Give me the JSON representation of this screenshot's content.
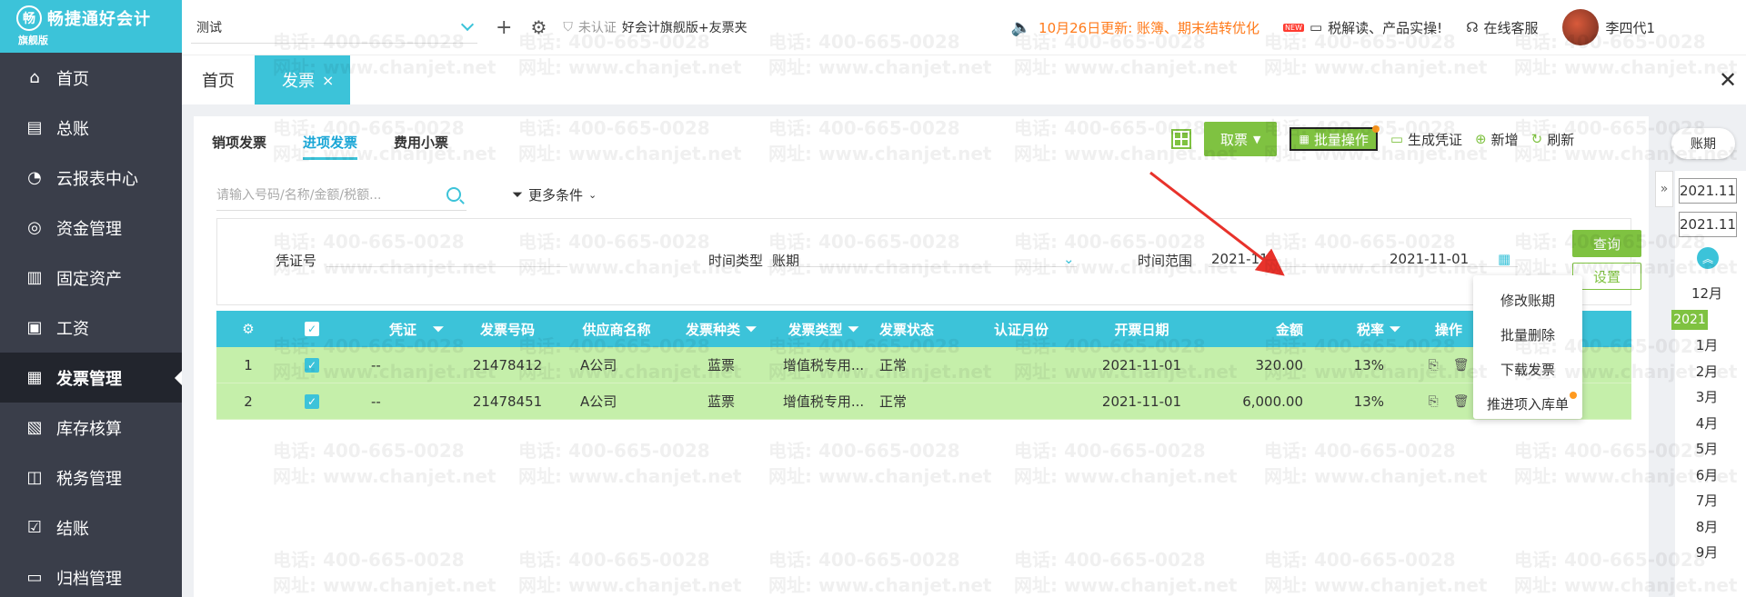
{
  "brand": {
    "logo_glyph": "畅",
    "name": "畅捷通好会计",
    "edition": "旗舰版"
  },
  "sidebar": {
    "items": [
      {
        "label": "首页",
        "icon": "home-icon"
      },
      {
        "label": "总账",
        "icon": "ledger-icon"
      },
      {
        "label": "云报表中心",
        "icon": "chart-icon"
      },
      {
        "label": "资金管理",
        "icon": "fund-icon"
      },
      {
        "label": "固定资产",
        "icon": "building-icon"
      },
      {
        "label": "工资",
        "icon": "salary-icon"
      },
      {
        "label": "发票管理",
        "icon": "invoice-icon",
        "active": true
      },
      {
        "label": "库存核算",
        "icon": "warehouse-icon"
      },
      {
        "label": "税务管理",
        "icon": "tax-icon"
      },
      {
        "label": "结账",
        "icon": "checkout-icon"
      },
      {
        "label": "归档管理",
        "icon": "archive-icon"
      }
    ]
  },
  "topbar": {
    "account": "测试",
    "cert_status": "未认证",
    "product": "好会计旗舰版+友票夹",
    "notice": "10月26日更新: 账簿、期末结转优化",
    "new_badge": "NEW",
    "video_link": "税解读、产品实操!",
    "support": "在线客服",
    "user_name": "李四代1"
  },
  "tabs": {
    "home": "首页",
    "invoice": "发票",
    "close": "×"
  },
  "sub_tabs": [
    "销项发票",
    "进项发票",
    "费用小票"
  ],
  "toolbar": {
    "take_invoice": "取票",
    "batch": "批量操作",
    "gen_voucher": "生成凭证",
    "add": "新增",
    "refresh": "刷新"
  },
  "period_tag": "账期",
  "dropdown": [
    "修改账期",
    "批量删除",
    "下载发票",
    "推进项入库单"
  ],
  "search": {
    "placeholder": "请输入号码/名称/金额/税额...",
    "more": "更多条件"
  },
  "filters": {
    "voucher_label": "凭证号",
    "time_type_label": "时间类型",
    "time_type_value": "账期",
    "range_label": "时间范围",
    "range_start": "2021-11-01",
    "range_end": "2021-11-01",
    "query": "查询",
    "setting": "设置"
  },
  "table": {
    "headers": [
      "凭证",
      "发票号码",
      "供应商名称",
      "发票种类",
      "发票类型",
      "发票状态",
      "认证月份",
      "开票日期",
      "金额",
      "税率",
      "操作"
    ],
    "rows": [
      {
        "no": "1",
        "voucher": "--",
        "number": "21478412",
        "supplier": "A公司",
        "kind": "蓝票",
        "type": "增值税专用...",
        "status": "正常",
        "cert_month": "",
        "date": "2021-11-01",
        "amount": "320.00",
        "rate": "13%"
      },
      {
        "no": "2",
        "voucher": "--",
        "number": "21478451",
        "supplier": "A公司",
        "kind": "蓝票",
        "type": "增值税专用...",
        "status": "正常",
        "cert_month": "",
        "date": "2021-11-01",
        "amount": "6,000.00",
        "rate": "13%"
      }
    ]
  },
  "period_panel": {
    "top1": "2021.11",
    "top2": "2021.11",
    "months": [
      "12月",
      "2021",
      "1月",
      "2月",
      "3月",
      "4月",
      "5月",
      "6月",
      "7月",
      "8月",
      "9月"
    ]
  },
  "watermark": {
    "phone": "电话: 400-665-0028",
    "site": "网址: www.chanjet.net"
  },
  "colors": {
    "accent": "#3cc3d9",
    "green": "#7fc241",
    "row": "#c5efaa",
    "sidebar": "#3a3e4a",
    "notice": "#ff7a1a",
    "arrow": "#e8322b"
  }
}
